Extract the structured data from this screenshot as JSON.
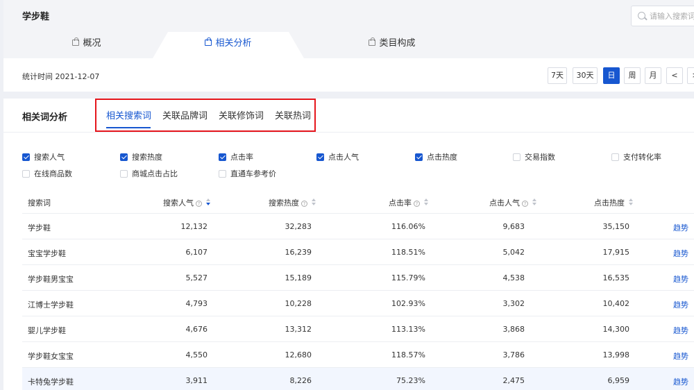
{
  "header": {
    "title": "学步鞋",
    "search_placeholder": "请输入搜索词"
  },
  "nav_tabs": [
    {
      "label": "概况",
      "active": false
    },
    {
      "label": "相关分析",
      "active": true
    },
    {
      "label": "类目构成",
      "active": false
    }
  ],
  "stat": {
    "date_text": "统计时间 2021-12-07"
  },
  "periods": [
    {
      "label": "7天",
      "active": false
    },
    {
      "label": "30天",
      "active": false
    },
    {
      "label": "日",
      "active": true
    },
    {
      "label": "周",
      "active": false
    },
    {
      "label": "月",
      "active": false
    },
    {
      "label": "<",
      "active": false
    },
    {
      "label": ">",
      "active": false
    }
  ],
  "section": {
    "title": "相关词分析",
    "subtabs": [
      {
        "label": "相关搜索词",
        "active": true
      },
      {
        "label": "关联品牌词",
        "active": false
      },
      {
        "label": "关联修饰词",
        "active": false
      },
      {
        "label": "关联热词",
        "active": false
      }
    ]
  },
  "metrics": [
    {
      "label": "搜索人气",
      "checked": true
    },
    {
      "label": "搜索热度",
      "checked": true
    },
    {
      "label": "点击率",
      "checked": true
    },
    {
      "label": "点击人气",
      "checked": true
    },
    {
      "label": "点击热度",
      "checked": true
    },
    {
      "label": "交易指数",
      "checked": false
    },
    {
      "label": "支付转化率",
      "checked": false
    },
    {
      "label": "在线商品数",
      "checked": false
    },
    {
      "label": "商城点击占比",
      "checked": false
    },
    {
      "label": "直通车参考价",
      "checked": false
    }
  ],
  "table": {
    "columns": [
      "搜索词",
      "搜索人气",
      "搜索热度",
      "点击率",
      "点击人气",
      "点击热度"
    ],
    "trend_label": "趋势",
    "rows": [
      [
        "学步鞋",
        "12,132",
        "32,283",
        "116.06%",
        "9,683",
        "35,150"
      ],
      [
        "宝宝学步鞋",
        "6,107",
        "16,239",
        "118.51%",
        "5,042",
        "17,915"
      ],
      [
        "学步鞋男宝宝",
        "5,527",
        "15,189",
        "115.79%",
        "4,538",
        "16,535"
      ],
      [
        "江博士学步鞋",
        "4,793",
        "10,228",
        "102.93%",
        "3,302",
        "10,402"
      ],
      [
        "婴儿学步鞋",
        "4,676",
        "13,312",
        "113.13%",
        "3,868",
        "14,300"
      ],
      [
        "学步鞋女宝宝",
        "4,550",
        "12,680",
        "118.57%",
        "3,786",
        "13,998"
      ],
      [
        "卡特兔学步鞋",
        "3,911",
        "8,226",
        "75.23%",
        "2,475",
        "6,959"
      ]
    ]
  },
  "colors": {
    "accent": "#1757d0",
    "highlight_frame": "#e5151b"
  }
}
